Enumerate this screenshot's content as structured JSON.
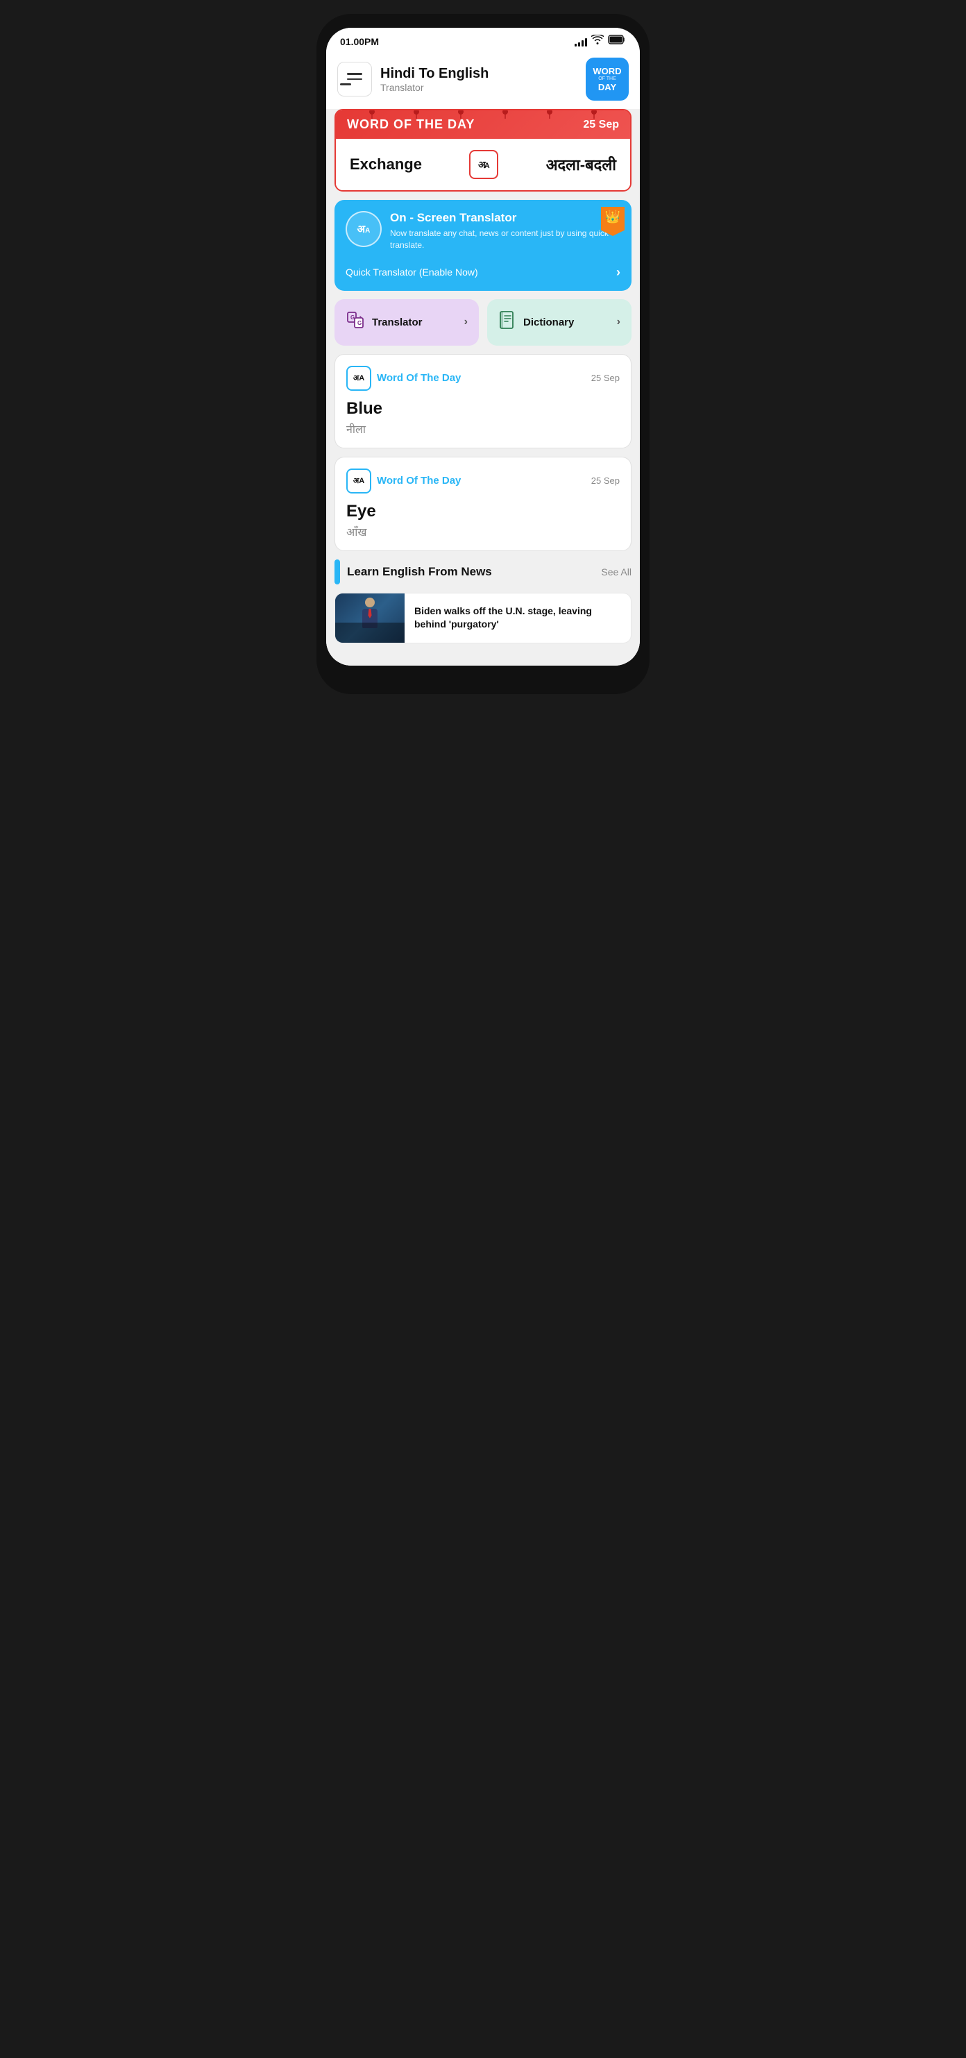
{
  "status_bar": {
    "time": "01.00PM",
    "signal_bars": [
      4,
      6,
      9,
      12,
      14
    ],
    "wifi": "wifi",
    "battery": "battery"
  },
  "header": {
    "menu_label": "menu",
    "title": "Hindi To English",
    "subtitle": "Translator",
    "badge": {
      "word": "WORD",
      "of_the": "OF THE",
      "day": "DAY"
    }
  },
  "wotd_banner": {
    "title": "WORD OF THE DAY",
    "date": "25 Sep",
    "english_word": "Exchange",
    "hindi_word": "अदला-बदली",
    "icon_text": "अA"
  },
  "on_screen_translator": {
    "title": "On - Screen Translator",
    "description": "Now translate any chat, news or content just by using quick translate.",
    "cta": "Quick Translator (Enable Now)",
    "icon_text": "अA"
  },
  "feature_cards": {
    "translator": {
      "label": "Translator",
      "icon": "🔄",
      "arrow": "›"
    },
    "dictionary": {
      "label": "Dictionary",
      "icon": "📖",
      "arrow": "›"
    }
  },
  "word_cards": [
    {
      "title": "Word Of The Day",
      "date": "25 Sep",
      "english": "Blue",
      "hindi": "नीला",
      "icon": "अA"
    },
    {
      "title": "Word Of The Day",
      "date": "25 Sep",
      "english": "Eye",
      "hindi": "आँख",
      "icon": "अA"
    }
  ],
  "news_section": {
    "title": "Learn English From News",
    "see_all": "See All",
    "article": {
      "headline": "Biden walks off the U.N. stage, leaving behind 'purgatory'",
      "has_image": true
    }
  }
}
